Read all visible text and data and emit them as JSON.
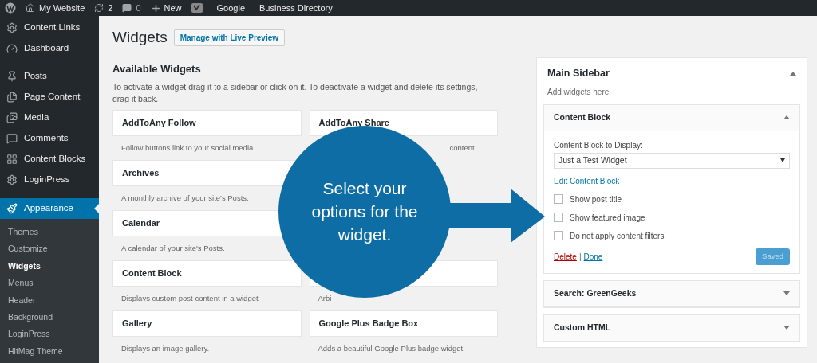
{
  "admin_bar": {
    "site": "My Website",
    "updates": "2",
    "comments": "0",
    "new": "New",
    "links": [
      "Google",
      "Business Directory"
    ]
  },
  "sidebar": {
    "items": [
      {
        "label": "Content Links",
        "selected": false
      },
      {
        "label": "Dashboard",
        "selected": false
      },
      {
        "label": "Posts",
        "selected": false
      },
      {
        "label": "Page Content",
        "selected": false
      },
      {
        "label": "Media",
        "selected": false
      },
      {
        "label": "Comments",
        "selected": false
      },
      {
        "label": "Content Blocks",
        "selected": false
      },
      {
        "label": "LoginPress",
        "selected": false
      },
      {
        "label": "Appearance",
        "selected": true
      }
    ],
    "submenu": [
      {
        "label": "Themes",
        "selected": false
      },
      {
        "label": "Customize",
        "selected": false
      },
      {
        "label": "Widgets",
        "selected": true
      },
      {
        "label": "Menus",
        "selected": false
      },
      {
        "label": "Header",
        "selected": false
      },
      {
        "label": "Background",
        "selected": false
      },
      {
        "label": "LoginPress",
        "selected": false
      },
      {
        "label": "HitMag Theme",
        "selected": false
      }
    ]
  },
  "page": {
    "title": "Widgets",
    "action_button": "Manage with Live Preview"
  },
  "available": {
    "heading": "Available Widgets",
    "description": "To activate a widget drag it to a sidebar or click on it. To deactivate a widget and delete its settings, drag it back.",
    "widgets": [
      {
        "kind": "full",
        "title": "AddToAny Follow",
        "description": "Follow buttons link to your social media."
      },
      {
        "kind": "tail",
        "title": "AddToAny Share",
        "description": "content."
      },
      {
        "kind": "full",
        "title": "Archives",
        "description": "A monthly archive of your site's Posts."
      },
      {
        "kind": "covered"
      },
      {
        "kind": "full",
        "title": "Calendar",
        "description": "A calendar of your site's Posts."
      },
      {
        "kind": "covered"
      },
      {
        "kind": "full",
        "title": "Content Block",
        "description": "Displays custom post content in a widget"
      },
      {
        "kind": "full",
        "description": "Arbi"
      },
      {
        "kind": "full",
        "title": "Gallery",
        "description": "Displays an image gallery."
      },
      {
        "kind": "full",
        "title": "Google Plus Badge Box",
        "description": "Adds a beautiful Google Plus badge widget."
      }
    ]
  },
  "sidebar_area": {
    "title": "Main Sidebar",
    "description": "Add widgets here.",
    "expanded": true,
    "widgets": [
      {
        "title": "Content Block",
        "expanded": true,
        "form": {
          "select_label": "Content Block to Display:",
          "select_value": "Just a Test Widget",
          "edit_link": "Edit Content Block",
          "options": [
            {
              "label": "Show post title",
              "checked": false
            },
            {
              "label": "Show featured image",
              "checked": false
            },
            {
              "label": "Do not apply content filters",
              "checked": false
            }
          ],
          "delete": "Delete",
          "separator": "|",
          "done": "Done",
          "save": "Saved",
          "save_disabled": true
        }
      },
      {
        "title": "Search: GreenGeeks",
        "expanded": false
      },
      {
        "title": "Custom HTML",
        "expanded": false
      }
    ]
  },
  "callout": {
    "text": "Select your options for the widget."
  }
}
